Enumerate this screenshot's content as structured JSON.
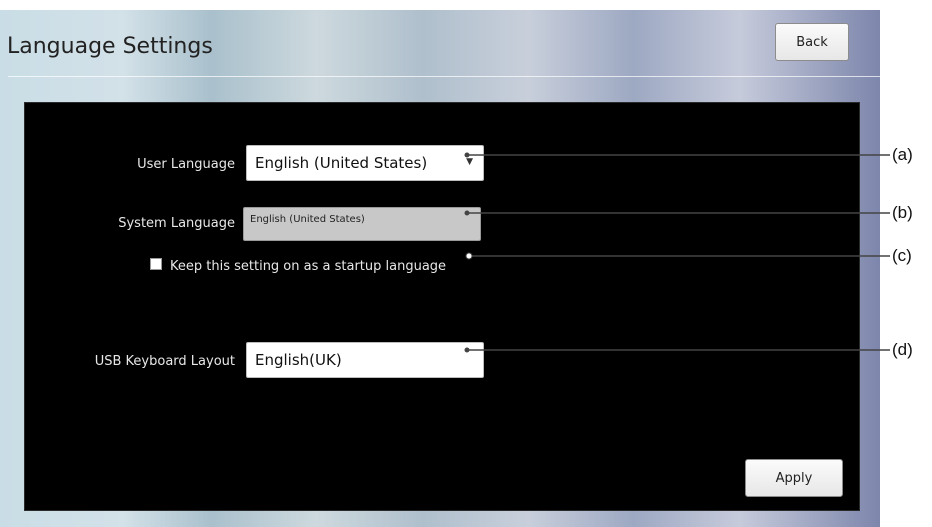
{
  "header": {
    "title": "Language Settings",
    "back_label": "Back"
  },
  "settings": {
    "user_language": {
      "label": "User Language",
      "value": "English (United States)"
    },
    "system_language": {
      "label": "System Language",
      "value": "English (United States)"
    },
    "keep_startup": {
      "label": "Keep this setting on as a startup language",
      "checked": false
    },
    "usb_keyboard": {
      "label": "USB Keyboard Layout",
      "value": "English(UK)"
    }
  },
  "footer": {
    "apply_label": "Apply"
  },
  "callouts": {
    "a": "(a)",
    "b": "(b)",
    "c": "(c)",
    "d": "(d)"
  }
}
